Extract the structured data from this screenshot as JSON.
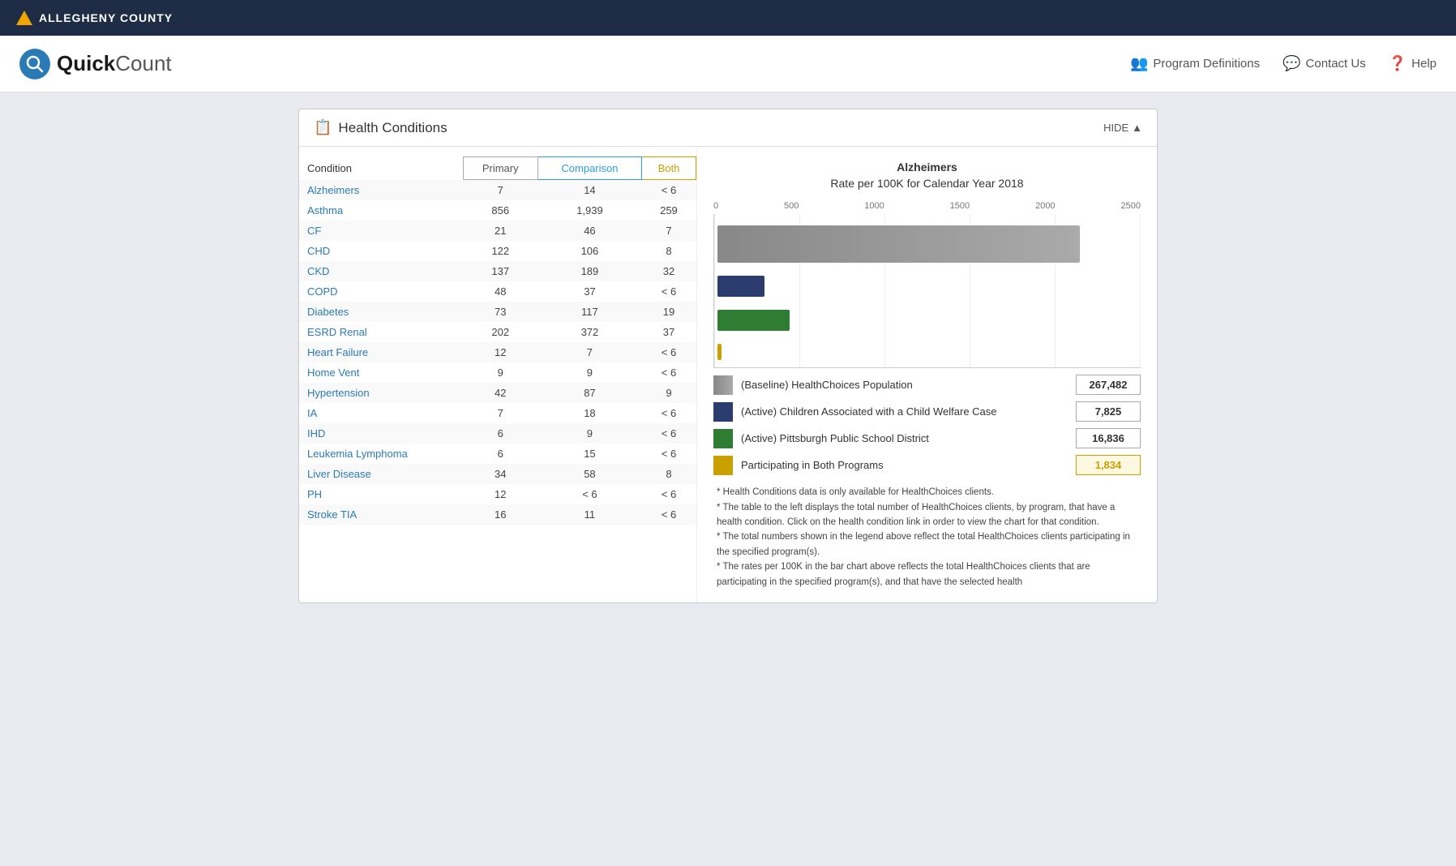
{
  "topbar": {
    "org_name": "ALLEGHENY COUNTY"
  },
  "header": {
    "brand_quick": "Quick",
    "brand_count": "Count",
    "nav": {
      "program_definitions": "Program Definitions",
      "contact_us": "Contact Us",
      "help": "Help"
    }
  },
  "panel": {
    "title": "Health Conditions",
    "hide_label": "HIDE",
    "table": {
      "col_condition": "Condition",
      "col_primary": "Primary",
      "col_comparison": "Comparison",
      "col_both": "Both",
      "rows": [
        {
          "condition": "Alzheimers",
          "primary": "7",
          "comparison": "14",
          "both": "< 6"
        },
        {
          "condition": "Asthma",
          "primary": "856",
          "comparison": "1,939",
          "both": "259"
        },
        {
          "condition": "CF",
          "primary": "21",
          "comparison": "46",
          "both": "7"
        },
        {
          "condition": "CHD",
          "primary": "122",
          "comparison": "106",
          "both": "8"
        },
        {
          "condition": "CKD",
          "primary": "137",
          "comparison": "189",
          "both": "32"
        },
        {
          "condition": "COPD",
          "primary": "48",
          "comparison": "37",
          "both": "< 6"
        },
        {
          "condition": "Diabetes",
          "primary": "73",
          "comparison": "117",
          "both": "19"
        },
        {
          "condition": "ESRD Renal",
          "primary": "202",
          "comparison": "372",
          "both": "37"
        },
        {
          "condition": "Heart Failure",
          "primary": "12",
          "comparison": "7",
          "both": "< 6"
        },
        {
          "condition": "Home Vent",
          "primary": "9",
          "comparison": "9",
          "both": "< 6"
        },
        {
          "condition": "Hypertension",
          "primary": "42",
          "comparison": "87",
          "both": "9"
        },
        {
          "condition": "IA",
          "primary": "7",
          "comparison": "18",
          "both": "< 6"
        },
        {
          "condition": "IHD",
          "primary": "6",
          "comparison": "9",
          "both": "< 6"
        },
        {
          "condition": "Leukemia Lymphoma",
          "primary": "6",
          "comparison": "15",
          "both": "< 6"
        },
        {
          "condition": "Liver Disease",
          "primary": "34",
          "comparison": "58",
          "both": "8"
        },
        {
          "condition": "PH",
          "primary": "12",
          "comparison": "< 6",
          "both": "< 6"
        },
        {
          "condition": "Stroke TIA",
          "primary": "16",
          "comparison": "11",
          "both": "< 6"
        }
      ]
    },
    "chart": {
      "title_line1": "Alzheimers",
      "title_line2": "Rate per 100K for Calendar Year 2018",
      "axis_labels": [
        "0",
        "500",
        "1000",
        "1500",
        "2000",
        "2500"
      ],
      "bars": {
        "baseline": {
          "color": "#888",
          "width_pct": 85,
          "label": "(Baseline) HealthChoices Population",
          "value": "267,482",
          "is_gold": false
        },
        "active": {
          "color": "#2a3d6e",
          "width_pct": 12,
          "label": "(Active) Children Associated with a Child Welfare Case",
          "value": "7,825",
          "is_gold": false
        },
        "pittsburgh": {
          "color": "#2e7d32",
          "width_pct": 18,
          "label": "(Active) Pittsburgh Public School District",
          "value": "16,836",
          "is_gold": false
        },
        "both": {
          "color": "#c8a000",
          "width_pct": 0,
          "label": "Participating in Both Programs",
          "value": "1,834",
          "is_gold": true
        }
      }
    },
    "notes": [
      "* Health Conditions data is only available for HealthChoices clients.",
      "* The table to the left displays the total number of HealthChoices clients, by program, that have a health condition. Click on the health condition link in order to view the chart for that condition.",
      "* The total numbers shown in the legend above reflect the total HealthChoices clients participating in the specified program(s).",
      "* The rates per 100K in the bar chart above reflects the total HealthChoices clients that are participating in the specified program(s), and that have the selected health"
    ]
  }
}
